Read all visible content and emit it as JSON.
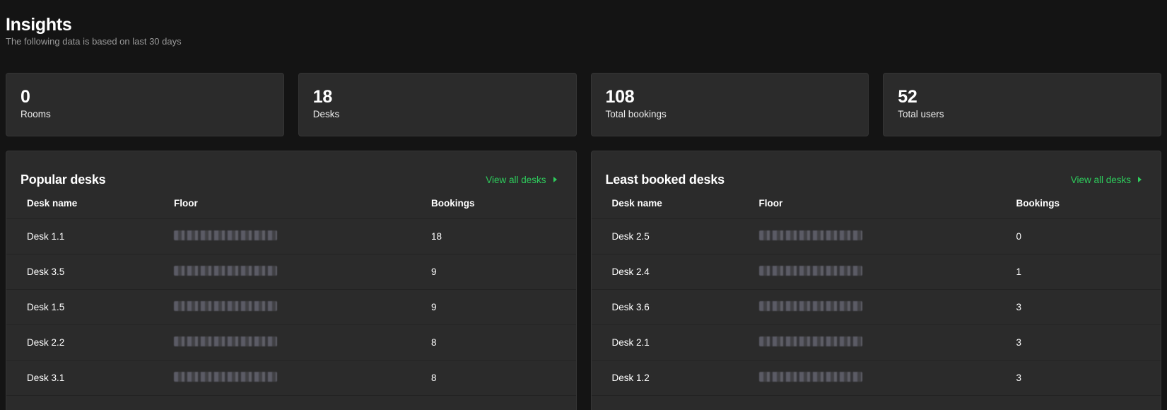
{
  "header": {
    "title": "Insights",
    "subtitle": "The following data is based on last 30 days"
  },
  "stats": [
    {
      "value": "0",
      "label": "Rooms"
    },
    {
      "value": "18",
      "label": "Desks"
    },
    {
      "value": "108",
      "label": "Total bookings"
    },
    {
      "value": "52",
      "label": "Total users"
    }
  ],
  "popular": {
    "title": "Popular desks",
    "view_all": "View all desks",
    "columns": [
      "Desk name",
      "Floor",
      "Bookings"
    ],
    "rows": [
      {
        "desk": "Desk 1.1",
        "bookings": "18"
      },
      {
        "desk": "Desk 3.5",
        "bookings": "9"
      },
      {
        "desk": "Desk 1.5",
        "bookings": "9"
      },
      {
        "desk": "Desk 2.2",
        "bookings": "8"
      },
      {
        "desk": "Desk 3.1",
        "bookings": "8"
      }
    ]
  },
  "least": {
    "title": "Least booked desks",
    "view_all": "View all desks",
    "columns": [
      "Desk name",
      "Floor",
      "Bookings"
    ],
    "rows": [
      {
        "desk": "Desk 2.5",
        "bookings": "0"
      },
      {
        "desk": "Desk 2.4",
        "bookings": "1"
      },
      {
        "desk": "Desk 3.6",
        "bookings": "3"
      },
      {
        "desk": "Desk 2.1",
        "bookings": "3"
      },
      {
        "desk": "Desk 1.2",
        "bookings": "3"
      }
    ]
  },
  "colors": {
    "background": "#141414",
    "card": "#2b2b2b",
    "accent": "#2ecc5c",
    "muted": "#9a9a9a"
  },
  "icons": {
    "view_all": "chevron-right-icon"
  }
}
